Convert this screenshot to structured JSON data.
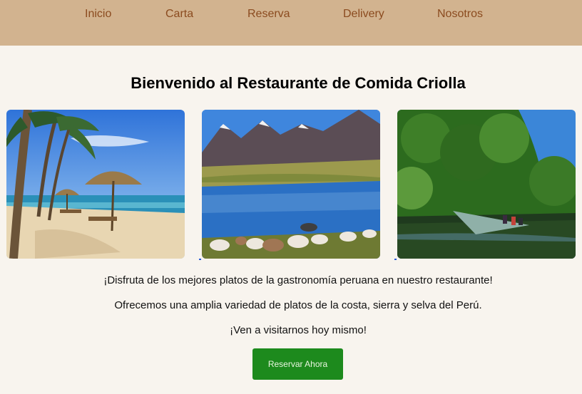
{
  "nav": {
    "items": [
      {
        "label": "Inicio"
      },
      {
        "label": "Carta"
      },
      {
        "label": "Reserva"
      },
      {
        "label": "Delivery"
      },
      {
        "label": "Nosotros"
      }
    ]
  },
  "hero": {
    "title": "Bienvenido al Restaurante de Comida Criolla"
  },
  "gallery": [
    {
      "subject": "beach-with-palm-umbrellas"
    },
    {
      "subject": "andean-lake-with-alpacas"
    },
    {
      "subject": "amazon-river-canoe"
    }
  ],
  "content": {
    "paragraph_1": "¡Disfruta de los mejores platos de la gastronomía peruana en nuestro restaurante!",
    "paragraph_2": "Ofrecemos una amplia variedad de platos de la costa, sierra y selva del Perú.",
    "paragraph_3": "¡Ven a visitarnos hoy mismo!"
  },
  "cta": {
    "label": "Reservar Ahora"
  },
  "colors": {
    "nav_bg": "#d2b38f",
    "nav_text": "#8b4b1f",
    "page_bg": "#f8f4ee",
    "button_bg": "#1d8a1d"
  }
}
